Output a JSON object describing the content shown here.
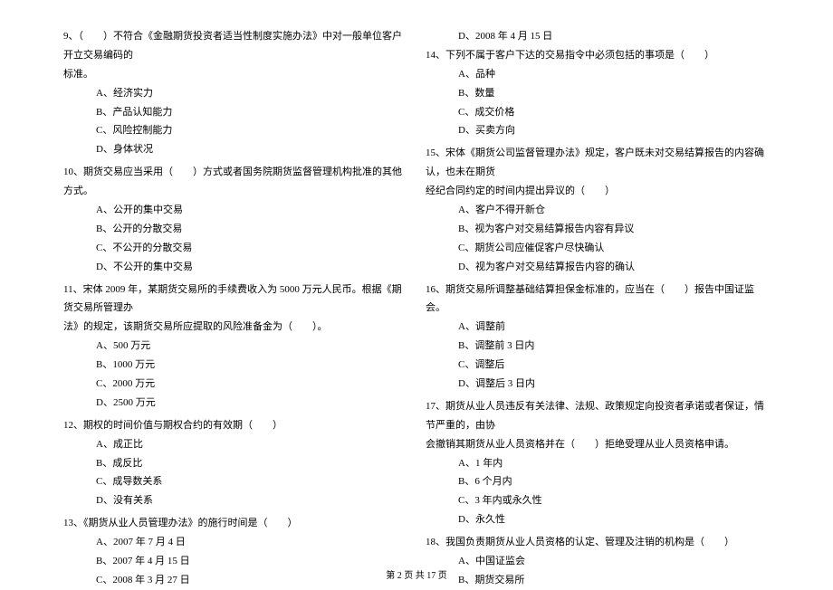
{
  "left": {
    "q9": {
      "text": "9、（　　）不符合《金融期货投资者适当性制度实施办法》中对一般单位客户开立交易编码的",
      "cont": "标准。",
      "opts": [
        "A、经济实力",
        "B、产品认知能力",
        "C、风险控制能力",
        "D、身体状况"
      ]
    },
    "q10": {
      "text": "10、期货交易应当采用（　　）方式或者国务院期货监督管理机构批准的其他方式。",
      "opts": [
        "A、公开的集中交易",
        "B、公开的分散交易",
        "C、不公开的分散交易",
        "D、不公开的集中交易"
      ]
    },
    "q11": {
      "text": "11、宋体 2009 年，某期货交易所的手续费收入为 5000 万元人民币。根据《期货交易所管理办",
      "cont": "法》的规定，该期货交易所应提取的风险准备金为（　　）。",
      "opts": [
        "A、500 万元",
        "B、1000 万元",
        "C、2000 万元",
        "D、2500 万元"
      ]
    },
    "q12": {
      "text": "12、期权的时间价值与期权合约的有效期（　　）",
      "opts": [
        "A、成正比",
        "B、成反比",
        "C、成导数关系",
        "D、没有关系"
      ]
    },
    "q13": {
      "text": "13、《期货从业人员管理办法》的施行时间是（　　）",
      "opts": [
        "A、2007 年 7 月 4 日",
        "B、2007 年 4 月 15 日",
        "C、2008 年 3 月 27 日"
      ]
    }
  },
  "right": {
    "q13d": "D、2008 年 4 月 15 日",
    "q14": {
      "text": "14、下列不属于客户下达的交易指令中必须包括的事项是（　　）",
      "opts": [
        "A、品种",
        "B、数量",
        "C、成交价格",
        "D、买卖方向"
      ]
    },
    "q15": {
      "text": "15、宋体《期货公司监督管理办法》规定，客户既未对交易结算报告的内容确认，也未在期货",
      "cont": "经纪合同约定的时间内提出异议的（　　）",
      "opts": [
        "A、客户不得开新仓",
        "B、视为客户对交易结算报告内容有异议",
        "C、期货公司应催促客户尽快确认",
        "D、视为客户对交易结算报告内容的确认"
      ]
    },
    "q16": {
      "text": "16、期货交易所调整基础结算担保金标准的，应当在（　　）报告中国证监会。",
      "opts": [
        "A、调整前",
        "B、调整前 3 日内",
        "C、调整后",
        "D、调整后 3 日内"
      ]
    },
    "q17": {
      "text": "17、期货从业人员违反有关法律、法规、政策规定向投资者承诺或者保证，情节严重的，由协",
      "cont": "会撤销其期货从业人员资格并在（　　）拒绝受理从业人员资格申请。",
      "opts": [
        "A、1 年内",
        "B、6 个月内",
        "C、3 年内或永久性",
        "D、永久性"
      ]
    },
    "q18": {
      "text": "18、我国负责期货从业人员资格的认定、管理及注销的机构是（　　）",
      "opts": [
        "A、中国证监会",
        "B、期货交易所"
      ]
    }
  },
  "footer": "第 2 页 共 17 页"
}
